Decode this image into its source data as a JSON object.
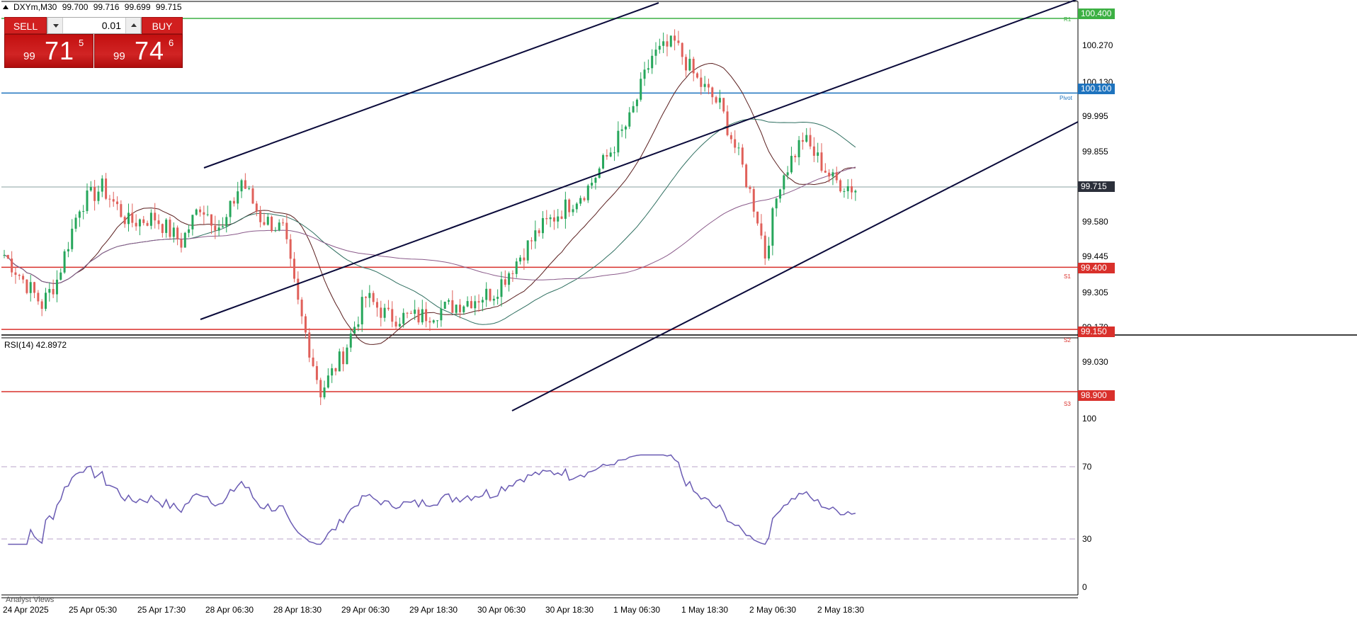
{
  "window": {
    "symbol_timeframe": "DXYm,M30",
    "ohlc": [
      "99.700",
      "99.716",
      "99.699",
      "99.715"
    ]
  },
  "trade_panel": {
    "sell_label": "SELL",
    "buy_label": "BUY",
    "lot_value": "0.01",
    "sell_price": {
      "small": "99",
      "big": "71",
      "sup": "5"
    },
    "buy_price": {
      "small": "99",
      "big": "74",
      "sup": "6"
    }
  },
  "price_axis": {
    "ticks": [
      "100.270",
      "100.130",
      "99.995",
      "99.855",
      "99.580",
      "99.445",
      "99.305",
      "99.170",
      "99.030"
    ],
    "current_price": "99.715"
  },
  "levels": [
    {
      "name": "R1",
      "price": 100.4,
      "label": "100.400",
      "color": "#3cb043"
    },
    {
      "name": "Pivot",
      "price": 100.1,
      "label": "100.100",
      "color": "#1e73be"
    },
    {
      "name": "S1",
      "price": 99.4,
      "label": "99.400",
      "color": "#d9302b"
    },
    {
      "name": "S2",
      "price": 99.15,
      "label": "99.150",
      "color": "#d9302b"
    },
    {
      "name": "S3",
      "price": 98.9,
      "label": "98.900",
      "color": "#d9302b"
    }
  ],
  "time_axis": {
    "labels": [
      "24 Apr 2025",
      "25 Apr 05:30",
      "25 Apr 17:30",
      "28 Apr 06:30",
      "28 Apr 18:30",
      "29 Apr 06:30",
      "29 Apr 18:30",
      "30 Apr 06:30",
      "30 Apr 18:30",
      "1 May 06:30",
      "1 May 18:30",
      "2 May 06:30",
      "2 May 18:30"
    ]
  },
  "rsi": {
    "title": "RSI(14) 42.8972",
    "ticks": [
      "100",
      "70",
      "30",
      "0"
    ]
  },
  "footer": {
    "tab_label": "Analyst Views"
  },
  "colors": {
    "bull_candle": "#26a65b",
    "bear_candle": "#e0605a",
    "channel_line": "#0a0a3a",
    "rsi_line": "#6a5bb3",
    "current_price_tag": "#2b2f3a"
  },
  "chart_data": {
    "type": "candlestick",
    "timeframe": "M30",
    "price_ylim": [
      98.88,
      100.42
    ],
    "rsi_ylim": [
      0,
      100
    ],
    "rsi_levels": [
      30,
      70
    ],
    "candle_count": 190,
    "close_path_anchors": [
      [
        0,
        99.45
      ],
      [
        10,
        99.25
      ],
      [
        14,
        99.35
      ],
      [
        20,
        99.65
      ],
      [
        26,
        99.72
      ],
      [
        33,
        99.58
      ],
      [
        40,
        99.6
      ],
      [
        47,
        99.5
      ],
      [
        52,
        99.65
      ],
      [
        58,
        99.55
      ],
      [
        63,
        99.75
      ],
      [
        68,
        99.6
      ],
      [
        74,
        99.55
      ],
      [
        78,
        99.25
      ],
      [
        84,
        98.9
      ],
      [
        90,
        99.05
      ],
      [
        96,
        99.28
      ],
      [
        102,
        99.2
      ],
      [
        110,
        99.2
      ],
      [
        120,
        99.25
      ],
      [
        130,
        99.3
      ],
      [
        142,
        99.55
      ],
      [
        155,
        99.72
      ],
      [
        166,
        99.99
      ],
      [
        172,
        100.25
      ],
      [
        178,
        100.3
      ],
      [
        184,
        100.15
      ],
      [
        190,
        100.05
      ],
      [
        196,
        99.8
      ],
      [
        200,
        99.6
      ],
      [
        202,
        99.45
      ],
      [
        206,
        99.75
      ],
      [
        212,
        99.92
      ],
      [
        220,
        99.75
      ],
      [
        226,
        99.715
      ]
    ]
  }
}
